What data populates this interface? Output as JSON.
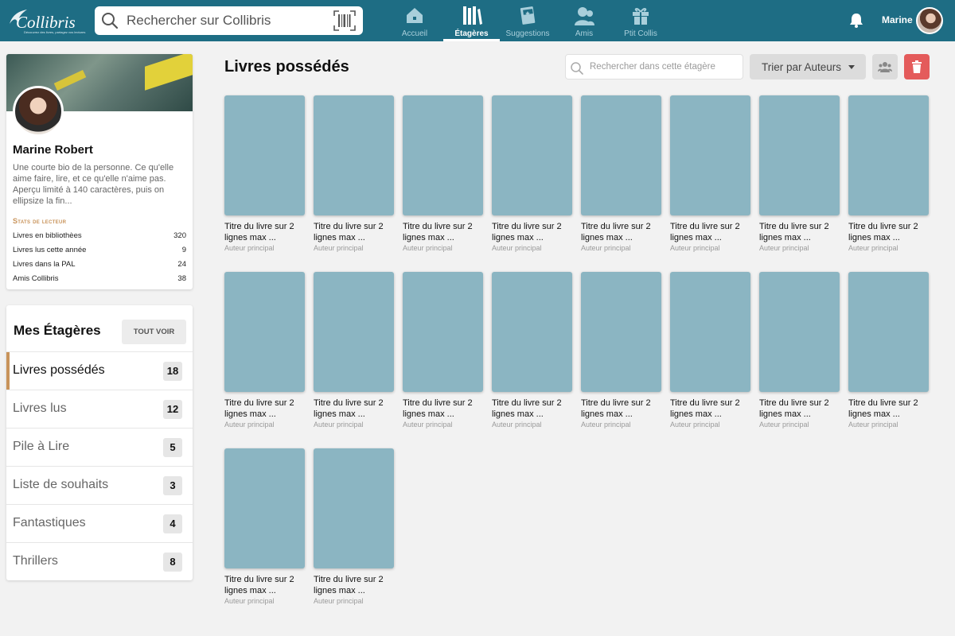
{
  "header": {
    "logo_text": "Collibris",
    "logo_tagline": "Découvrez des livres, partagez vos lectures",
    "search_placeholder": "Rechercher sur Collibris",
    "nav": [
      {
        "label": "Accueil",
        "icon": "home-icon",
        "active": false
      },
      {
        "label": "Étagères",
        "icon": "books-icon",
        "active": true
      },
      {
        "label": "Suggestions",
        "icon": "suggestion-card-icon",
        "active": false
      },
      {
        "label": "Amis",
        "icon": "friends-icon",
        "active": false
      },
      {
        "label": "Ptit Collis",
        "icon": "gift-icon",
        "active": false
      }
    ],
    "user_name": "Marine",
    "colors": {
      "bar": "#1e6d84",
      "inactive": "#a9cfdb"
    }
  },
  "profile": {
    "name": "Marine Robert",
    "bio": "Une courte bio de la personne. Ce qu'elle aime faire, lire, et ce qu'elle n'aime pas. Aperçu limité à 140 caractères, puis on ellipsize la fin...",
    "stats_title": "Stats de lecteur",
    "stats": [
      {
        "label": "Livres en bibliothèes",
        "value": "320"
      },
      {
        "label": "Livres lus cette année",
        "value": "9"
      },
      {
        "label": "Livres dans la PAL",
        "value": "24"
      },
      {
        "label": "Amis Collibris",
        "value": "38"
      }
    ]
  },
  "shelves": {
    "title": "Mes Étagères",
    "see_all": "TOUT VOIR",
    "items": [
      {
        "label": "Livres possédés",
        "count": "18",
        "active": true
      },
      {
        "label": "Livres lus",
        "count": "12",
        "active": false
      },
      {
        "label": "Pile à Lire",
        "count": "5",
        "active": false
      },
      {
        "label": "Liste de souhaits",
        "count": "3",
        "active": false
      },
      {
        "label": "Fantastiques",
        "count": "4",
        "active": false
      },
      {
        "label": "Thrillers",
        "count": "8",
        "active": false
      }
    ],
    "accent_color": "#c8935a"
  },
  "main": {
    "title": "Livres possédés",
    "search_placeholder": "Rechercher dans cette étagère",
    "sort_label": "Trier par Auteurs",
    "books": [
      {
        "title": "Titre du livre sur 2 lignes max ...",
        "author": "Auteur principal"
      },
      {
        "title": "Titre du livre sur 2 lignes max ...",
        "author": "Auteur principal"
      },
      {
        "title": "Titre du livre sur 2 lignes max ...",
        "author": "Auteur principal"
      },
      {
        "title": "Titre du livre sur 2 lignes max ...",
        "author": "Auteur principal"
      },
      {
        "title": "Titre du livre sur 2 lignes max ...",
        "author": "Auteur principal"
      },
      {
        "title": "Titre du livre sur 2 lignes max ...",
        "author": "Auteur principal"
      },
      {
        "title": "Titre du livre sur 2 lignes max ...",
        "author": "Auteur principal"
      },
      {
        "title": "Titre du livre sur 2 lignes max ...",
        "author": "Auteur principal"
      },
      {
        "title": "Titre du livre sur 2 lignes max ...",
        "author": "Auteur principal"
      },
      {
        "title": "Titre du livre sur 2 lignes max ...",
        "author": "Auteur principal"
      },
      {
        "title": "Titre du livre sur 2 lignes max ...",
        "author": "Auteur principal"
      },
      {
        "title": "Titre du livre sur 2 lignes max ...",
        "author": "Auteur principal"
      },
      {
        "title": "Titre du livre sur 2 lignes max ...",
        "author": "Auteur principal"
      },
      {
        "title": "Titre du livre sur 2 lignes max ...",
        "author": "Auteur principal"
      },
      {
        "title": "Titre du livre sur 2 lignes max ...",
        "author": "Auteur principal"
      },
      {
        "title": "Titre du livre sur 2 lignes max ...",
        "author": "Auteur principal"
      },
      {
        "title": "Titre du livre sur 2 lignes max ...",
        "author": "Auteur principal"
      },
      {
        "title": "Titre du livre sur 2 lignes max ...",
        "author": "Auteur principal"
      }
    ],
    "cover_color": "#8bb5c2",
    "delete_color": "#e45b5b"
  }
}
